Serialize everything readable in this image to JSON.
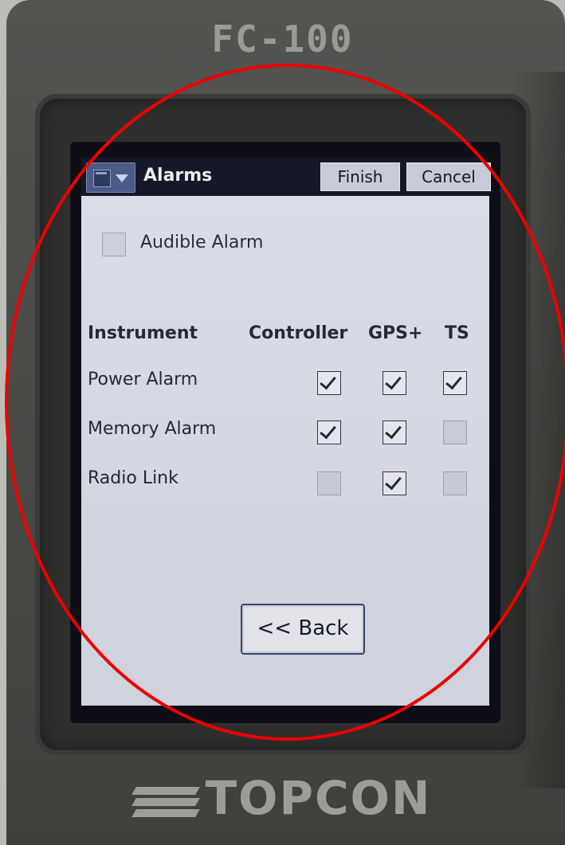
{
  "device": {
    "model": "FC-100",
    "brand": "TOPCON"
  },
  "titlebar": {
    "title": "Alarms",
    "finish_label": "Finish",
    "cancel_label": "Cancel"
  },
  "options": {
    "audible_alarm_label": "Audible Alarm",
    "audible_alarm_checked": false
  },
  "table": {
    "headers": [
      "Instrument",
      "Controller",
      "GPS+",
      "TS"
    ],
    "rows": [
      {
        "label": "Power Alarm",
        "controller": true,
        "gps": true,
        "ts": true
      },
      {
        "label": "Memory Alarm",
        "controller": true,
        "gps": true,
        "ts": false
      },
      {
        "label": "Radio Link",
        "controller": false,
        "gps": true,
        "ts": false
      }
    ]
  },
  "footer": {
    "back_label": "<< Back"
  },
  "colors": {
    "annotation": "#e00000",
    "titlebar": "#151826",
    "screen_bg": "#d7dbe6"
  }
}
